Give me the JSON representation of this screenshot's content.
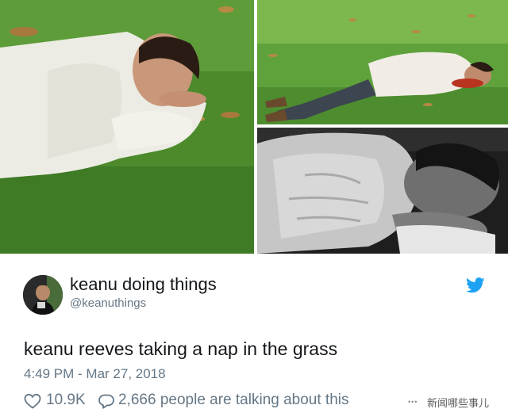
{
  "photos": [
    {
      "name": "nap-photo-left"
    },
    {
      "name": "nap-photo-top-right"
    },
    {
      "name": "nap-photo-bottom-right"
    }
  ],
  "tweet": {
    "display_name": "keanu doing things",
    "handle": "@keanuthings",
    "text": "keanu reeves taking a nap in the grass",
    "timestamp": "4:49 PM - Mar 27, 2018",
    "likes": "10.9K",
    "talking": "2,666 people are talking about this",
    "icons": {
      "likes": "heart-icon",
      "talking": "reply-bubble-icon",
      "brand": "twitter-bird-icon"
    }
  },
  "watermark": {
    "text": "新闻哪些事儿"
  },
  "colors": {
    "twitter_blue": "#1da1f2",
    "secondary_text": "#657786",
    "primary_text": "#14171a"
  }
}
